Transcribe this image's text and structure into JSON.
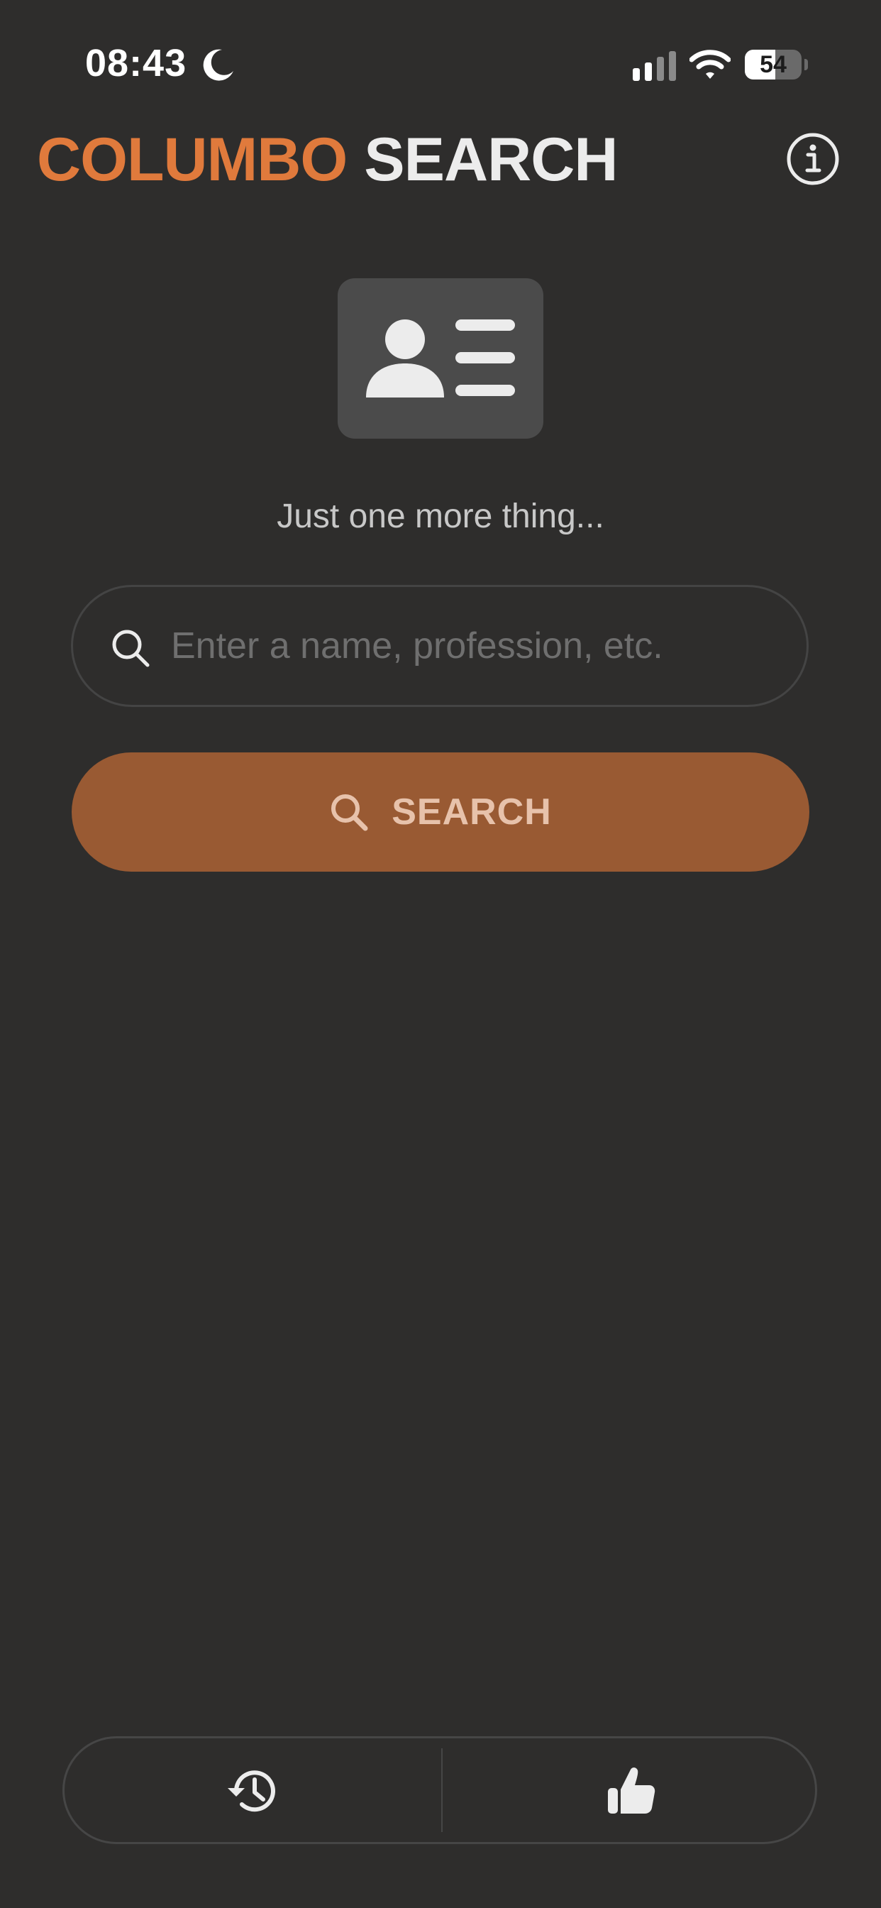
{
  "status_bar": {
    "time": "08:43",
    "battery_level": 54,
    "battery_text": "54",
    "icons": [
      "moon-icon",
      "cellular-signal-icon",
      "wifi-icon",
      "battery-icon"
    ]
  },
  "header": {
    "title_accent": "COLUMBO",
    "title_main": "SEARCH",
    "info_icon": "info-circle-icon"
  },
  "hero": {
    "icon": "contact-card-icon",
    "tagline": "Just one more thing..."
  },
  "search": {
    "placeholder": "Enter a name, profession, etc.",
    "value": "",
    "button_label": "SEARCH",
    "icon": "magnifying-glass-icon"
  },
  "bottom_bar": {
    "items": [
      {
        "icon": "history-icon"
      },
      {
        "icon": "thumbs-up-icon"
      }
    ]
  },
  "colors": {
    "background": "#2e2d2c",
    "accent": "#e07a3c",
    "button": "#995a33",
    "button_text": "#e7c2ab",
    "card": "#4b4b4b"
  }
}
